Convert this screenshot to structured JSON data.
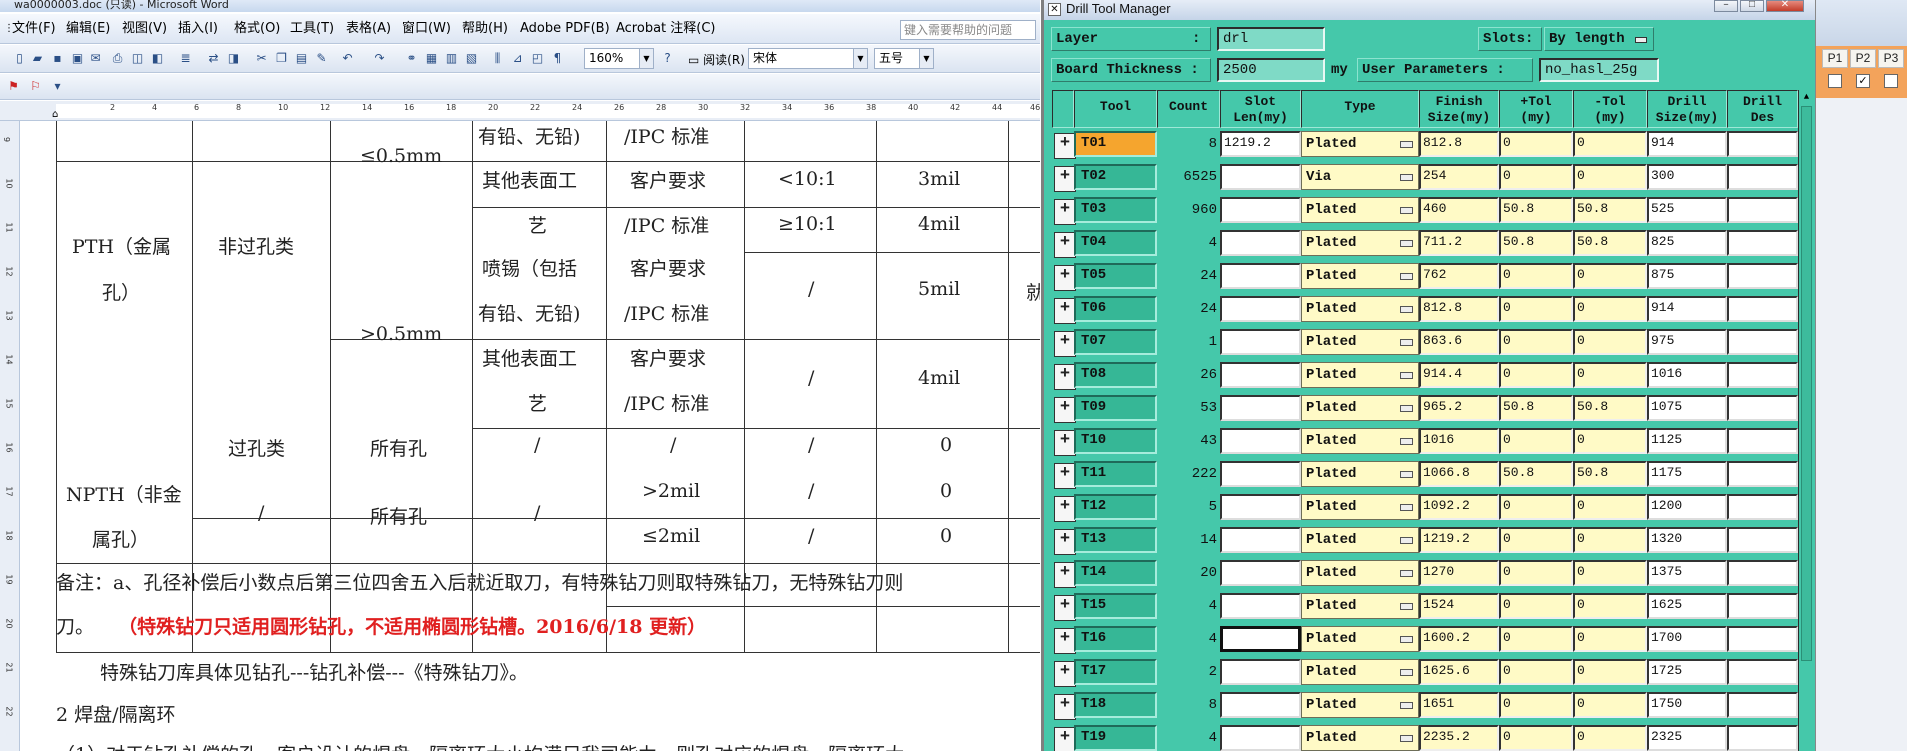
{
  "word": {
    "title": "wa0000003.doc (只读) - Microsoft Word",
    "menu": [
      "文件(F)",
      "编辑(E)",
      "视图(V)",
      "插入(I)",
      "格式(O)",
      "工具(T)",
      "表格(A)",
      "窗口(W)",
      "帮助(H)",
      "Adobe PDF(B)",
      "Acrobat 注释(C)"
    ],
    "help_placeholder": "键入需要帮助的问题",
    "zoom": "160%",
    "read_label": "阅读(R)",
    "font_name": "宋体",
    "font_size": "五号",
    "ruler_ticks": [
      "2",
      "4",
      "6",
      "8",
      "10",
      "12",
      "14",
      "16",
      "18",
      "20",
      "22",
      "24",
      "26",
      "28",
      "30",
      "32",
      "34",
      "36",
      "38",
      "40",
      "42",
      "44",
      "46"
    ],
    "vruler_ticks": [
      "9",
      "10",
      "11",
      "12",
      "13",
      "14",
      "15",
      "16",
      "17",
      "18",
      "19",
      "20",
      "21",
      "22"
    ],
    "table": {
      "c_r1_c4": "有铅、无铅)",
      "c_r1_c5": "/IPC 标准",
      "c_lt05": "≤0.5mm",
      "c_other1_a": "其他表面工",
      "c_other1_b": "艺",
      "c_cust1_a": "客户要求",
      "c_cust1_b": "/IPC 标准",
      "c_lt10": "<10:1",
      "c_3mil": "3mil",
      "c_ge10": "≥10:1",
      "c_4mil_a": "4mil",
      "c_pth_a": "PTH（金属",
      "c_pth_b": "孔）",
      "c_nonvia": "非过孔类",
      "c_gt05": ">0.5mm",
      "c_spray_a": "喷锡（包括",
      "c_spray_b": "有铅、无铅)",
      "c_cust2_a": "客户要求",
      "c_cust2_b": "/IPC 标准",
      "c_slash1": "/",
      "c_5mil": "5mil",
      "c_other2_a": "其他表面工",
      "c_other2_b": "艺",
      "c_cust3_a": "客户要求",
      "c_cust3_b": "/IPC 标准",
      "c_slash2": "/",
      "c_4mil_b": "4mil",
      "c_via": "过孔类",
      "c_allhole1": "所有孔",
      "c_slash3": "/",
      "c_slash4": "/",
      "c_slash5": "/",
      "c_zero1": "0",
      "c_npth_a": "NPTH（非金",
      "c_npth_b": "属孔）",
      "c_slash6": "/",
      "c_allhole2": "所有孔",
      "c_slash7": "/",
      "c_gt2mil": ">2mil",
      "c_slash8": "/",
      "c_zero2": "0",
      "c_le2mil": "≤2mil",
      "c_slash9": "/",
      "c_zero3": "0",
      "c_edge": "就"
    },
    "note1": "备注：a、孔径补偿后小数点后第三位四舍五入后就近取刀，有特殊钻刀则取特殊钻刀，无特殊钻刀则",
    "note2_a": "刀。",
    "note2_b": "（特殊钻刀只适用圆形钻孔，不适用椭圆形钻槽。2016/6/18 更新）",
    "note3": "特殊钻刀库具体见钻孔---钻孔补偿---《特殊钻刀》。",
    "note4": "2 焊盘/隔离环",
    "note5": "（1）对于钻孔补偿的孔，客户设计的焊盘、隔离环大小均满足我司能力，则孔对应的焊盘、隔离环大"
  },
  "dtm": {
    "title": "Drill Tool Manager",
    "layer_label": "Layer",
    "layer_colon": ":",
    "layer_value": "drl",
    "slots_label": "Slots:",
    "slots_value": "By length",
    "thickness_label": "Board Thickness :",
    "thickness_value": "2500",
    "thickness_unit": "my",
    "user_params_label": "User Parameters :",
    "user_params_value": "no_hasl_25g",
    "headers": {
      "tool": "Tool",
      "count": "Count",
      "slot1": "Slot",
      "slot2": "Len(my)",
      "type": "Type",
      "finish1": "Finish",
      "finish2": "Size(my)",
      "ptol1": "+Tol",
      "ptol2": "(my)",
      "mtol1": "-Tol",
      "mtol2": "(my)",
      "drill1": "Drill",
      "drill2": "Size(my)",
      "des1": "Drill",
      "des2": "Des"
    },
    "rows": [
      {
        "tool": "T01",
        "count": "8",
        "slot": "1219.2",
        "type": "Plated",
        "finish": "812.8",
        "ptol": "0",
        "mtol": "0",
        "drill": "914"
      },
      {
        "tool": "T02",
        "count": "6525",
        "slot": "",
        "type": "Via",
        "finish": "254",
        "ptol": "0",
        "mtol": "0",
        "drill": "300"
      },
      {
        "tool": "T03",
        "count": "960",
        "slot": "",
        "type": "Plated",
        "finish": "460",
        "ptol": "50.8",
        "mtol": "50.8",
        "drill": "525"
      },
      {
        "tool": "T04",
        "count": "4",
        "slot": "",
        "type": "Plated",
        "finish": "711.2",
        "ptol": "50.8",
        "mtol": "50.8",
        "drill": "825"
      },
      {
        "tool": "T05",
        "count": "24",
        "slot": "",
        "type": "Plated",
        "finish": "762",
        "ptol": "0",
        "mtol": "0",
        "drill": "875"
      },
      {
        "tool": "T06",
        "count": "24",
        "slot": "",
        "type": "Plated",
        "finish": "812.8",
        "ptol": "0",
        "mtol": "0",
        "drill": "914"
      },
      {
        "tool": "T07",
        "count": "1",
        "slot": "",
        "type": "Plated",
        "finish": "863.6",
        "ptol": "0",
        "mtol": "0",
        "drill": "975"
      },
      {
        "tool": "T08",
        "count": "26",
        "slot": "",
        "type": "Plated",
        "finish": "914.4",
        "ptol": "0",
        "mtol": "0",
        "drill": "1016"
      },
      {
        "tool": "T09",
        "count": "53",
        "slot": "",
        "type": "Plated",
        "finish": "965.2",
        "ptol": "50.8",
        "mtol": "50.8",
        "drill": "1075"
      },
      {
        "tool": "T10",
        "count": "43",
        "slot": "",
        "type": "Plated",
        "finish": "1016",
        "ptol": "0",
        "mtol": "0",
        "drill": "1125"
      },
      {
        "tool": "T11",
        "count": "222",
        "slot": "",
        "type": "Plated",
        "finish": "1066.8",
        "ptol": "50.8",
        "mtol": "50.8",
        "drill": "1175"
      },
      {
        "tool": "T12",
        "count": "5",
        "slot": "",
        "type": "Plated",
        "finish": "1092.2",
        "ptol": "0",
        "mtol": "0",
        "drill": "1200"
      },
      {
        "tool": "T13",
        "count": "14",
        "slot": "",
        "type": "Plated",
        "finish": "1219.2",
        "ptol": "0",
        "mtol": "0",
        "drill": "1320"
      },
      {
        "tool": "T14",
        "count": "20",
        "slot": "",
        "type": "Plated",
        "finish": "1270",
        "ptol": "0",
        "mtol": "0",
        "drill": "1375"
      },
      {
        "tool": "T15",
        "count": "4",
        "slot": "",
        "type": "Plated",
        "finish": "1524",
        "ptol": "0",
        "mtol": "0",
        "drill": "1625"
      },
      {
        "tool": "T16",
        "count": "4",
        "slot": "",
        "type": "Plated",
        "finish": "1600.2",
        "ptol": "0",
        "mtol": "0",
        "drill": "1700"
      },
      {
        "tool": "T17",
        "count": "2",
        "slot": "",
        "type": "Plated",
        "finish": "1625.6",
        "ptol": "0",
        "mtol": "0",
        "drill": "1725"
      },
      {
        "tool": "T18",
        "count": "8",
        "slot": "",
        "type": "Plated",
        "finish": "1651",
        "ptol": "0",
        "mtol": "0",
        "drill": "1750"
      },
      {
        "tool": "T19",
        "count": "4",
        "slot": "",
        "type": "Plated",
        "finish": "2235.2",
        "ptol": "0",
        "mtol": "0",
        "drill": "2325"
      }
    ],
    "selected_tool": "T01",
    "focused_slot_row": 15,
    "colors": {
      "bg": "#45c8aa",
      "tool_selected": "#f5a52e",
      "field_yellow": "#fffac6"
    }
  },
  "strip": {
    "headers": [
      "P1",
      "P2",
      "P3"
    ],
    "checked": [
      false,
      true,
      false
    ],
    "check_glyph": "✓"
  }
}
